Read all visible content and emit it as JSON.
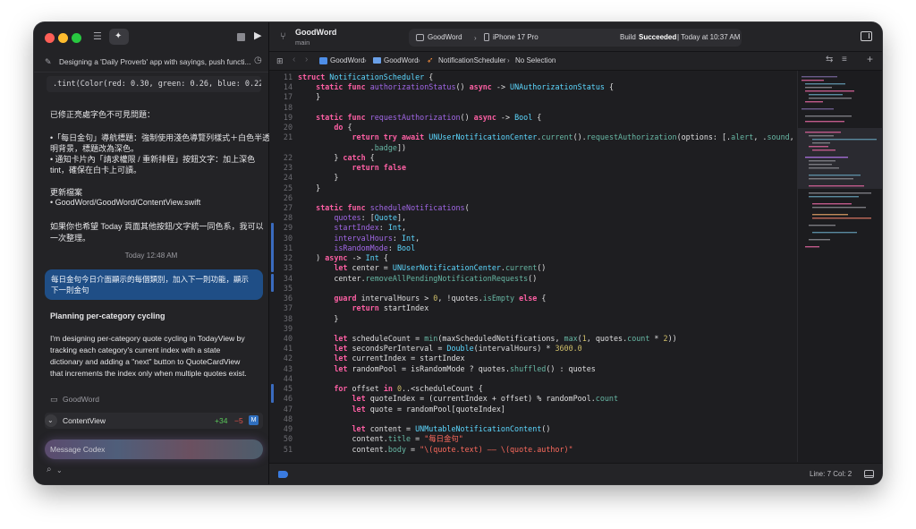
{
  "left_panel": {
    "thread_title": "Designing a 'Daily Proverb' app with sayings, push functi...",
    "code_snippet": ".tint(Color(red: 0.30, green: 0.26, blue: 0.22)",
    "summary_heading": "已修正亮處字色不可見問題：",
    "bullet1_line1": "•「每日金句」導航標題：強制使用淺色導覽列樣式＋白色半透",
    "bullet1_line2": "明背景，標題改為深色。",
    "bullet2_line1": "• 通知卡片內「請求權限 / 重新排程」按鈕文字：加上深色",
    "bullet2_line2": "tint，確保在白卡上可讀。",
    "updated_files_label": "更新檔案",
    "updated_file_path": "• GoodWord/GoodWord/ContentView.swift",
    "followup_line1": "如果你也希望 Today 頁面其他按鈕/文字統一同色系，我可以",
    "followup_line2": "一次整理。",
    "timestamp": "Today 12:48 AM",
    "user_msg_line1": "每日金句今日介面顯示的每個類別，加入下一則功能，顯示",
    "user_msg_line2": "下一則金句",
    "planning_heading": "Planning per-category cycling",
    "planning_line1": "I'm designing per-category quote cycling in TodayView by",
    "planning_line2": "tracking each category's current index with a state",
    "planning_line3": "dictionary and adding a \"next\" button to QuoteCardView",
    "planning_line4": "that increments the index only when multiple quotes exist.",
    "folder_name": "GoodWord",
    "changed_file": "ContentView",
    "additions": "+34",
    "deletions": "−5",
    "modified_badge": "M",
    "message_placeholder": "Message Codex"
  },
  "toolbar": {
    "project_name": "GoodWord",
    "branch": "main",
    "scheme": "GoodWord",
    "device": "iPhone 17 Pro",
    "build_status_prefix": "Build",
    "build_status_word": "Succeeded",
    "build_time": "| Today at 10:37 AM"
  },
  "jump_bar": {
    "crumbs": [
      "GoodWord",
      "GoodWord",
      "NotificationScheduler",
      "No Selection"
    ]
  },
  "status_bar": {
    "cursor": "Line: 7  Col: 2"
  },
  "code_lines": [
    {
      "n": "11",
      "c": [
        [
          "k",
          "struct "
        ],
        [
          "t",
          "NotificationScheduler"
        ],
        [
          "p",
          " {"
        ]
      ]
    },
    {
      "n": "14",
      "c": [
        [
          "p",
          "    "
        ],
        [
          "k",
          "static func "
        ],
        [
          "f",
          "authorizationStatus"
        ],
        [
          "p",
          "() "
        ],
        [
          "k",
          "async"
        ],
        [
          "p",
          " -> "
        ],
        [
          "t",
          "UNAuthorizationStatus"
        ],
        [
          "p",
          " {"
        ]
      ]
    },
    {
      "n": "17",
      "c": [
        [
          "p",
          "    }"
        ]
      ]
    },
    {
      "n": "18",
      "c": [
        [
          "p",
          ""
        ]
      ]
    },
    {
      "n": "19",
      "c": [
        [
          "p",
          "    "
        ],
        [
          "k",
          "static func "
        ],
        [
          "f",
          "requestAuthorization"
        ],
        [
          "p",
          "() "
        ],
        [
          "k",
          "async"
        ],
        [
          "p",
          " -> "
        ],
        [
          "t",
          "Bool"
        ],
        [
          "p",
          " {"
        ]
      ]
    },
    {
      "n": "20",
      "c": [
        [
          "p",
          "        "
        ],
        [
          "k",
          "do"
        ],
        [
          "p",
          " {"
        ]
      ]
    },
    {
      "n": "21",
      "c": [
        [
          "p",
          "            "
        ],
        [
          "k",
          "return try await "
        ],
        [
          "t",
          "UNUserNotificationCenter"
        ],
        [
          "p",
          "."
        ],
        [
          "v",
          "current"
        ],
        [
          "p",
          "()."
        ],
        [
          "v",
          "requestAuthorization"
        ],
        [
          "p",
          "(options: [."
        ],
        [
          "v",
          "alert"
        ],
        [
          "p",
          ", ."
        ],
        [
          "v",
          "sound"
        ],
        [
          "p",
          ","
        ]
      ]
    },
    {
      "n": "",
      "c": [
        [
          "p",
          "                ."
        ],
        [
          "v",
          "badge"
        ],
        [
          "p",
          "])"
        ]
      ]
    },
    {
      "n": "22",
      "c": [
        [
          "p",
          "        } "
        ],
        [
          "k",
          "catch"
        ],
        [
          "p",
          " {"
        ]
      ]
    },
    {
      "n": "23",
      "c": [
        [
          "p",
          "            "
        ],
        [
          "k",
          "return false"
        ]
      ]
    },
    {
      "n": "24",
      "c": [
        [
          "p",
          "        }"
        ]
      ]
    },
    {
      "n": "25",
      "c": [
        [
          "p",
          "    }"
        ]
      ]
    },
    {
      "n": "26",
      "c": [
        [
          "p",
          ""
        ]
      ]
    },
    {
      "n": "27",
      "c": [
        [
          "p",
          "    "
        ],
        [
          "k",
          "static func "
        ],
        [
          "f",
          "scheduleNotifications"
        ],
        [
          "p",
          "("
        ]
      ]
    },
    {
      "n": "28",
      "c": [
        [
          "p",
          "        "
        ],
        [
          "f",
          "quotes"
        ],
        [
          "p",
          ": ["
        ],
        [
          "t",
          "Quote"
        ],
        [
          "p",
          "],"
        ]
      ]
    },
    {
      "n": "29",
      "c": [
        [
          "p",
          "        "
        ],
        [
          "f",
          "startIndex"
        ],
        [
          "p",
          ": "
        ],
        [
          "t",
          "Int"
        ],
        [
          "p",
          ","
        ]
      ]
    },
    {
      "n": "30",
      "c": [
        [
          "p",
          "        "
        ],
        [
          "f",
          "intervalHours"
        ],
        [
          "p",
          ": "
        ],
        [
          "t",
          "Int"
        ],
        [
          "p",
          ","
        ]
      ]
    },
    {
      "n": "31",
      "c": [
        [
          "p",
          "        "
        ],
        [
          "f",
          "isRandomMode"
        ],
        [
          "p",
          ": "
        ],
        [
          "t",
          "Bool"
        ]
      ]
    },
    {
      "n": "32",
      "c": [
        [
          "p",
          "    ) "
        ],
        [
          "k",
          "async"
        ],
        [
          "p",
          " -> "
        ],
        [
          "t",
          "Int"
        ],
        [
          "p",
          " {"
        ]
      ]
    },
    {
      "n": "33",
      "c": [
        [
          "p",
          "        "
        ],
        [
          "k",
          "let "
        ],
        [
          "p",
          "center = "
        ],
        [
          "t",
          "UNUserNotificationCenter"
        ],
        [
          "p",
          "."
        ],
        [
          "v",
          "current"
        ],
        [
          "p",
          "()"
        ]
      ]
    },
    {
      "n": "34",
      "c": [
        [
          "p",
          "        center."
        ],
        [
          "v",
          "removeAllPendingNotificationRequests"
        ],
        [
          "p",
          "()"
        ]
      ]
    },
    {
      "n": "35",
      "c": [
        [
          "p",
          ""
        ]
      ]
    },
    {
      "n": "36",
      "c": [
        [
          "p",
          "        "
        ],
        [
          "k",
          "guard "
        ],
        [
          "p",
          "intervalHours > "
        ],
        [
          "n",
          "0"
        ],
        [
          "p",
          ", !quotes."
        ],
        [
          "v",
          "isEmpty"
        ],
        [
          "p",
          " "
        ],
        [
          "k",
          "else"
        ],
        [
          "p",
          " {"
        ]
      ]
    },
    {
      "n": "37",
      "c": [
        [
          "p",
          "            "
        ],
        [
          "k",
          "return "
        ],
        [
          "p",
          "startIndex"
        ]
      ]
    },
    {
      "n": "38",
      "c": [
        [
          "p",
          "        }"
        ]
      ]
    },
    {
      "n": "39",
      "c": [
        [
          "p",
          ""
        ]
      ]
    },
    {
      "n": "40",
      "c": [
        [
          "p",
          "        "
        ],
        [
          "k",
          "let "
        ],
        [
          "p",
          "scheduleCount = "
        ],
        [
          "v",
          "min"
        ],
        [
          "p",
          "(maxScheduledNotifications, "
        ],
        [
          "v",
          "max"
        ],
        [
          "p",
          "("
        ],
        [
          "n",
          "1"
        ],
        [
          "p",
          ", quotes."
        ],
        [
          "v",
          "count"
        ],
        [
          "p",
          " * "
        ],
        [
          "n",
          "2"
        ],
        [
          "p",
          "))"
        ]
      ]
    },
    {
      "n": "41",
      "c": [
        [
          "p",
          "        "
        ],
        [
          "k",
          "let "
        ],
        [
          "p",
          "secondsPerInterval = "
        ],
        [
          "t",
          "Double"
        ],
        [
          "p",
          "(intervalHours) * "
        ],
        [
          "n",
          "3600.0"
        ]
      ]
    },
    {
      "n": "42",
      "c": [
        [
          "p",
          "        "
        ],
        [
          "k",
          "let "
        ],
        [
          "p",
          "currentIndex = startIndex"
        ]
      ]
    },
    {
      "n": "43",
      "c": [
        [
          "p",
          "        "
        ],
        [
          "k",
          "let "
        ],
        [
          "p",
          "randomPool = isRandomMode ? quotes."
        ],
        [
          "v",
          "shuffled"
        ],
        [
          "p",
          "() : quotes"
        ]
      ]
    },
    {
      "n": "44",
      "c": [
        [
          "p",
          ""
        ]
      ]
    },
    {
      "n": "45",
      "c": [
        [
          "p",
          "        "
        ],
        [
          "k",
          "for "
        ],
        [
          "p",
          "offset "
        ],
        [
          "k",
          "in "
        ],
        [
          "n",
          "0"
        ],
        [
          "p",
          "..<scheduleCount {"
        ]
      ]
    },
    {
      "n": "46",
      "c": [
        [
          "p",
          "            "
        ],
        [
          "k",
          "let "
        ],
        [
          "p",
          "quoteIndex = (currentIndex + offset) % randomPool."
        ],
        [
          "v",
          "count"
        ]
      ]
    },
    {
      "n": "47",
      "c": [
        [
          "p",
          "            "
        ],
        [
          "k",
          "let "
        ],
        [
          "p",
          "quote = randomPool[quoteIndex]"
        ]
      ]
    },
    {
      "n": "48",
      "c": [
        [
          "p",
          ""
        ]
      ]
    },
    {
      "n": "49",
      "c": [
        [
          "p",
          "            "
        ],
        [
          "k",
          "let "
        ],
        [
          "p",
          "content = "
        ],
        [
          "t",
          "UNMutableNotificationContent"
        ],
        [
          "p",
          "()"
        ]
      ]
    },
    {
      "n": "50",
      "c": [
        [
          "p",
          "            content."
        ],
        [
          "v",
          "title"
        ],
        [
          "p",
          " = "
        ],
        [
          "s",
          "\"每日金句\""
        ]
      ]
    },
    {
      "n": "51",
      "c": [
        [
          "p",
          "            content."
        ],
        [
          "v",
          "body"
        ],
        [
          "p",
          " = "
        ],
        [
          "s",
          "\"\\(quote.text) —— \\(quote.author)\""
        ]
      ]
    }
  ],
  "colors": {
    "accent": "#1f4e86",
    "keyword": "#fc5fa3",
    "type": "#5dd8ff",
    "string": "#fc6a5d",
    "additions": "#5ac85a",
    "deletions": "#e5534b"
  }
}
